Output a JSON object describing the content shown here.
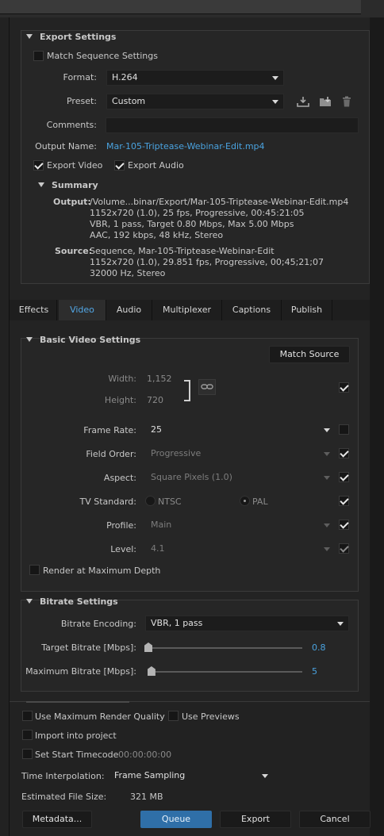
{
  "export_settings": {
    "title": "Export Settings",
    "match_sequence": "Match Sequence Settings",
    "format_label": "Format:",
    "format_value": "H.264",
    "preset_label": "Preset:",
    "preset_value": "Custom",
    "comments_label": "Comments:",
    "output_name_label": "Output Name:",
    "output_name_value": "Mar-105-Triptease-Webinar-Edit.mp4",
    "export_video": "Export Video",
    "export_audio": "Export Audio",
    "summary_title": "Summary",
    "output_label": "Output:",
    "output_lines": [
      "/Volume...binar/Export/Mar-105-Triptease-Webinar-Edit.mp4",
      "1152x720 (1.0), 25 fps, Progressive, 00:45:21:05",
      "VBR, 1 pass, Target 0.80 Mbps, Max 5.00 Mbps",
      "AAC, 192 kbps, 48 kHz, Stereo"
    ],
    "source_label": "Source:",
    "source_lines": [
      "Sequence, Mar-105-Triptease-Webinar-Edit",
      "1152x720 (1.0), 29.851 fps, Progressive, 00;45;21;07",
      "32000 Hz, Stereo"
    ]
  },
  "tabs": [
    "Effects",
    "Video",
    "Audio",
    "Multiplexer",
    "Captions",
    "Publish"
  ],
  "basic_video": {
    "title": "Basic Video Settings",
    "match_source": "Match Source",
    "width_label": "Width:",
    "width_value": "1,152",
    "height_label": "Height:",
    "height_value": "720",
    "frame_rate_label": "Frame Rate:",
    "frame_rate_value": "25",
    "field_order_label": "Field Order:",
    "field_order_value": "Progressive",
    "aspect_label": "Aspect:",
    "aspect_value": "Square Pixels (1.0)",
    "tv_standard_label": "TV Standard:",
    "tv_ntsc": "NTSC",
    "tv_pal": "PAL",
    "profile_label": "Profile:",
    "profile_value": "Main",
    "level_label": "Level:",
    "level_value": "4.1",
    "render_max_depth": "Render at Maximum Depth"
  },
  "bitrate": {
    "title": "Bitrate Settings",
    "encoding_label": "Bitrate Encoding:",
    "encoding_value": "VBR, 1 pass",
    "target_label": "Target Bitrate [Mbps]:",
    "target_value": "0.8",
    "target_fraction": 0.0,
    "max_label": "Maximum Bitrate [Mbps]:",
    "max_value": "5",
    "max_fraction": 0.02
  },
  "bottom": {
    "use_max_render": "Use Maximum Render Quality",
    "use_previews": "Use Previews",
    "import_project": "Import into project",
    "set_start_timecode": "Set Start Timecode",
    "timecode_value": "00:00:00:00",
    "time_interp_label": "Time Interpolation:",
    "time_interp_value": "Frame Sampling",
    "file_size_label": "Estimated File Size:",
    "file_size_value": "321 MB",
    "metadata_btn": "Metadata...",
    "queue_btn": "Queue",
    "export_btn": "Export",
    "cancel_btn": "Cancel"
  },
  "colors": {
    "accent": "#4aa3e0",
    "queue": "#2f6fa8",
    "panel": "#262626"
  }
}
